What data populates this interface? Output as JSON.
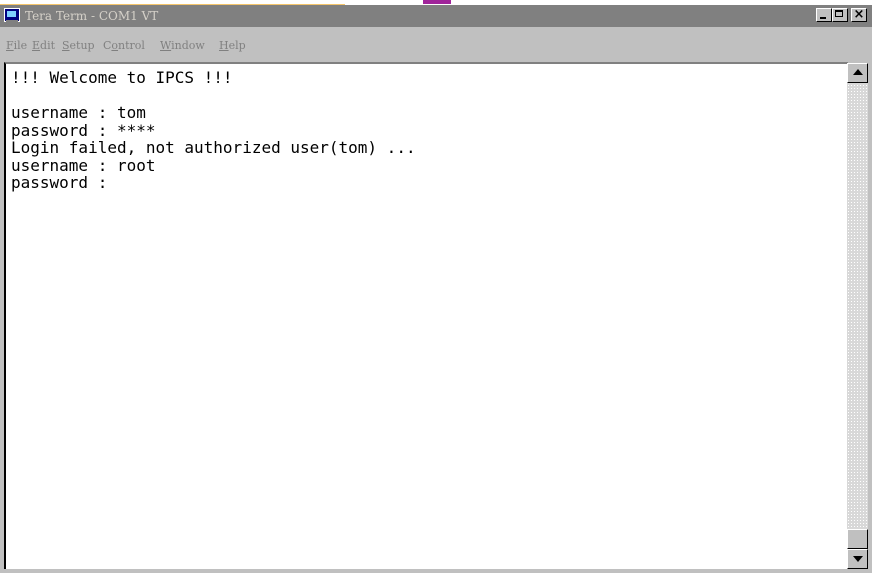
{
  "window": {
    "title": "Tera Term - COM1 VT",
    "icon": "tera-term-app-icon",
    "controls": {
      "minimize_icon": "minimize-icon",
      "maximize_icon": "maximize-icon",
      "close_label": "×"
    }
  },
  "menubar": {
    "items": [
      {
        "mnemonic": "F",
        "rest": "ile"
      },
      {
        "mnemonic": "E",
        "rest": "dit"
      },
      {
        "mnemonic": "S",
        "rest": "etup"
      },
      {
        "lead": "C",
        "mnemonic": "o",
        "rest": "ntrol"
      },
      {
        "mnemonic": "W",
        "rest": "indow"
      },
      {
        "mnemonic": "H",
        "rest": "elp"
      }
    ]
  },
  "terminal": {
    "lines": [
      "!!! Welcome to IPCS !!!",
      "",
      "username : tom",
      "password : ****",
      "Login failed, not authorized user(tom) ...",
      "username : root",
      "password :"
    ]
  },
  "colors": {
    "titlebar_inactive": "#808080",
    "window_face": "#c0c0c0",
    "terminal_bg": "#ffffff",
    "terminal_fg": "#000000"
  }
}
